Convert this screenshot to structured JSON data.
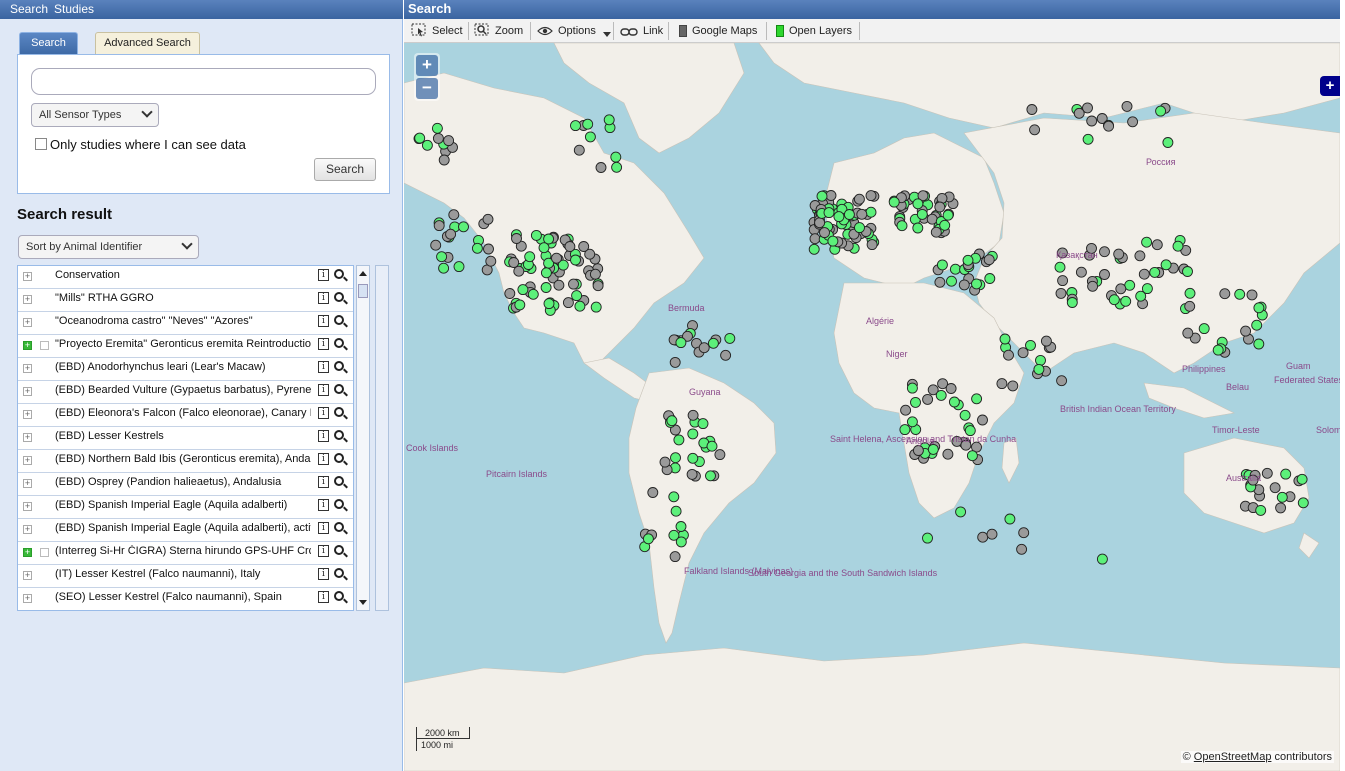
{
  "topnav": {
    "search": "Search",
    "studies": "Studies"
  },
  "search_panel": {
    "tabs": [
      "Search",
      "Advanced Search"
    ],
    "query_value": "",
    "sensor_select": "All Sensor Types",
    "only_checkbox_label": "Only studies where I can see data",
    "search_button": "Search"
  },
  "results": {
    "title": "Search result",
    "sort_select": "Sort by Animal Identifier",
    "rows": [
      {
        "label": "Conservation",
        "expandable": false
      },
      {
        "label": "\"Mills\" RTHA GGRO",
        "expandable": false
      },
      {
        "label": "\"Oceanodroma castro\" \"Neves\" \"Azores\"",
        "expandable": false
      },
      {
        "label": "\"Proyecto Eremita\" Geronticus eremita Reintroduction",
        "expandable": true
      },
      {
        "label": "(EBD) Anodorhynchus leari (Lear's Macaw)",
        "expandable": false
      },
      {
        "label": "(EBD) Bearded Vulture (Gypaetus barbatus), Pyrenees",
        "expandable": false
      },
      {
        "label": "(EBD) Eleonora's Falcon (Falco eleonorae), Canary Is",
        "expandable": false
      },
      {
        "label": "(EBD) Lesser Kestrels",
        "expandable": false
      },
      {
        "label": "(EBD) Northern Bald Ibis (Geronticus eremita), Andalu",
        "expandable": false
      },
      {
        "label": "(EBD) Osprey (Pandion halieaetus), Andalusia",
        "expandable": false
      },
      {
        "label": "(EBD) Spanish Imperial Eagle (Aquila adalberti)",
        "expandable": false
      },
      {
        "label": "(EBD) Spanish Imperial Eagle (Aquila adalberti), active",
        "expandable": false
      },
      {
        "label": "(Interreg Si-Hr ČIGRA) Sterna hirundo GPS-UHF Crc",
        "expandable": true
      },
      {
        "label": "(IT) Lesser Kestrel (Falco naumanni), Italy",
        "expandable": false
      },
      {
        "label": "(SEO) Lesser Kestrel (Falco naumanni), Spain",
        "expandable": false
      }
    ]
  },
  "map_panel": {
    "title": "Search",
    "toolbar": {
      "select": "Select",
      "zoom": "Zoom",
      "options": "Options",
      "link": "Link",
      "google_maps": "Google Maps",
      "open_layers": "Open Layers"
    },
    "zoom_in": "+",
    "zoom_out": "−",
    "scale_km": "2000 km",
    "scale_mi": "1000 mi",
    "attribution_prefix": "©",
    "attribution_link": "OpenStreetMap",
    "attribution_suffix": "contributors",
    "place_labels": [
      "Россия",
      "Bermuda",
      "Guyana",
      "Algérie",
      "Niger",
      "Angola",
      "Pitcairn Islands",
      "Cook Islands",
      "Guam",
      "Federated States of Micronesia",
      "Australia",
      "Belau",
      "Philippines",
      "South Georgia and the South Sandwich Islands",
      "Saint Helena, Ascension and Tristan da Cunha",
      "British Indian Ocean Territory",
      "Solomon Islands",
      "Timor-Leste",
      "Falkland Islands (Malvinas)",
      "Қазақстан"
    ],
    "colors": {
      "marker_green": "#5cf07a",
      "marker_gray": "#9a9a9a",
      "land": "#f2efe9",
      "water": "#aad3df"
    }
  }
}
